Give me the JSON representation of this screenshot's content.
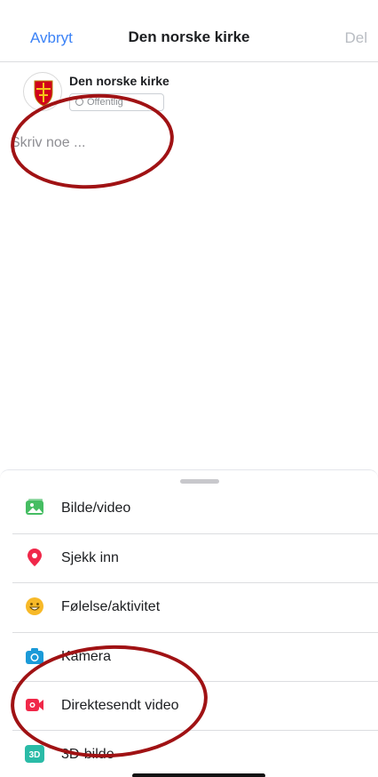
{
  "header": {
    "cancel_label": "Avbryt",
    "title": "Den norske kirke",
    "share_label": "Del"
  },
  "author": {
    "name": "Den norske kirke",
    "privacy_label": "Offentlig"
  },
  "composer": {
    "placeholder": "Skriv noe ..."
  },
  "menu": {
    "items": [
      {
        "label": "Bilde/video",
        "icon": "photo-video-icon"
      },
      {
        "label": "Sjekk inn",
        "icon": "location-pin-icon"
      },
      {
        "label": "Følelse/aktivitet",
        "icon": "smiley-icon"
      },
      {
        "label": "Kamera",
        "icon": "camera-icon"
      },
      {
        "label": "Direktesendt video",
        "icon": "live-video-icon"
      },
      {
        "label": "3D-bilde",
        "icon": "3d-photo-icon"
      }
    ]
  },
  "colors": {
    "accent": "#3b82f6",
    "annotation": "#a01214",
    "photo_green": "#45bd62",
    "pin_pink": "#f0284a",
    "smiley_yellow": "#f7b928",
    "camera_blue": "#1b9ad8",
    "live_red": "#f02849",
    "teal_3d": "#2abba7"
  }
}
